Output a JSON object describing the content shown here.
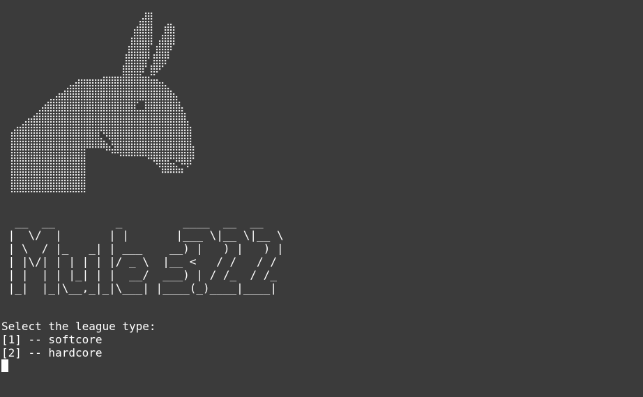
{
  "terminal": {
    "background": "#3b3b3b",
    "foreground": "#ffffff"
  },
  "logo": {
    "icon": "mule-head-dot-art",
    "banner_lines": [
      "  __  __         _         ____  __  __ ",
      " |  \\/  |       | |       |___ \\|__ \\|__ \\",
      " | \\  / |_   _| | ___    __) |   ) |   ) |",
      " | |\\/| | | | | |/ _ \\  |__ <   / /   / /",
      " | |  | | |_| | |  __/  ___) | / /_  / /_",
      " |_|  |_|\\__,_|_|\\___| |____(_)____|____|"
    ]
  },
  "prompt": {
    "question": "Select the league type:",
    "options": [
      "[1] -- softcore",
      "[2] -- hardcore"
    ]
  }
}
